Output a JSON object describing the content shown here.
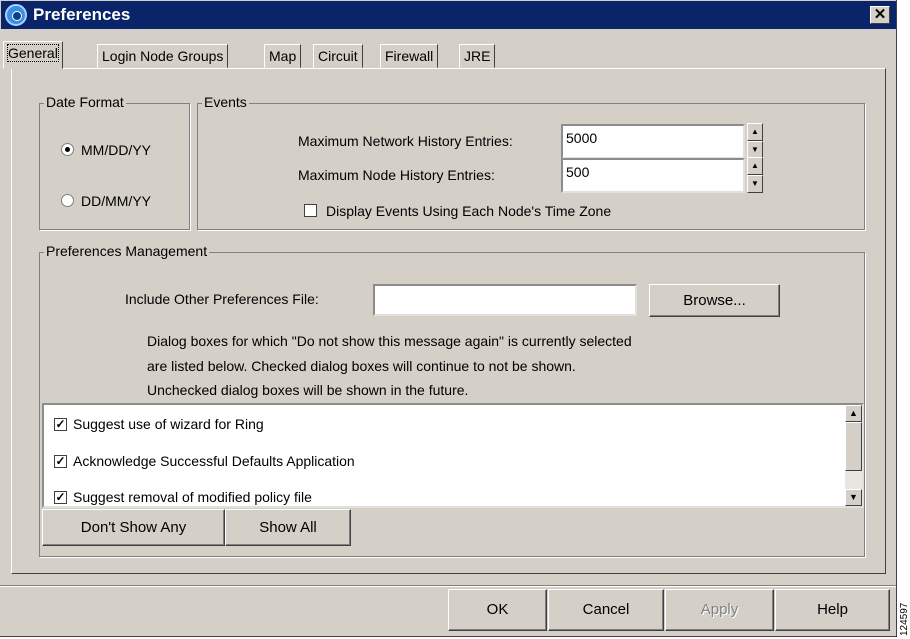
{
  "window": {
    "title": "Preferences",
    "close_glyph": "✕"
  },
  "tabs": [
    {
      "label": "General"
    },
    {
      "label": "Login Node Groups"
    },
    {
      "label": "Map"
    },
    {
      "label": "Circuit"
    },
    {
      "label": "Firewall"
    },
    {
      "label": "JRE"
    }
  ],
  "date_format": {
    "legend": "Date Format",
    "options": [
      {
        "label": "MM/DD/YY",
        "checked": true
      },
      {
        "label": "DD/MM/YY",
        "checked": false
      }
    ]
  },
  "events": {
    "legend": "Events",
    "network_history_label": "Maximum Network History Entries:",
    "network_history_value": "5000",
    "node_history_label": "Maximum Node History Entries:",
    "node_history_value": "500",
    "timezone_label": "Display Events Using Each Node's Time Zone",
    "timezone_checked": false
  },
  "prefs_management": {
    "legend": "Preferences Management",
    "include_label": "Include Other Preferences File:",
    "include_value": "",
    "browse_label": "Browse...",
    "description": [
      "Dialog boxes for which \"Do not show this message again\" is currently selected",
      "are listed below. Checked dialog boxes will continue to not be shown.",
      "Unchecked dialog boxes will be shown in the future."
    ],
    "dialog_list": [
      {
        "label": "Suggest use of wizard for Ring",
        "checked": true
      },
      {
        "label": "Acknowledge Successful Defaults Application",
        "checked": true
      },
      {
        "label": "Suggest removal of modified policy file",
        "checked": true
      }
    ],
    "dont_show_any_label": "Don't Show Any",
    "show_all_label": "Show All"
  },
  "footer": {
    "ok_label": "OK",
    "cancel_label": "Cancel",
    "apply_label": "Apply",
    "help_label": "Help"
  },
  "figure_id": "124597",
  "icons": {
    "check": "✓",
    "arrow_up": "▲",
    "arrow_down": "▼"
  }
}
